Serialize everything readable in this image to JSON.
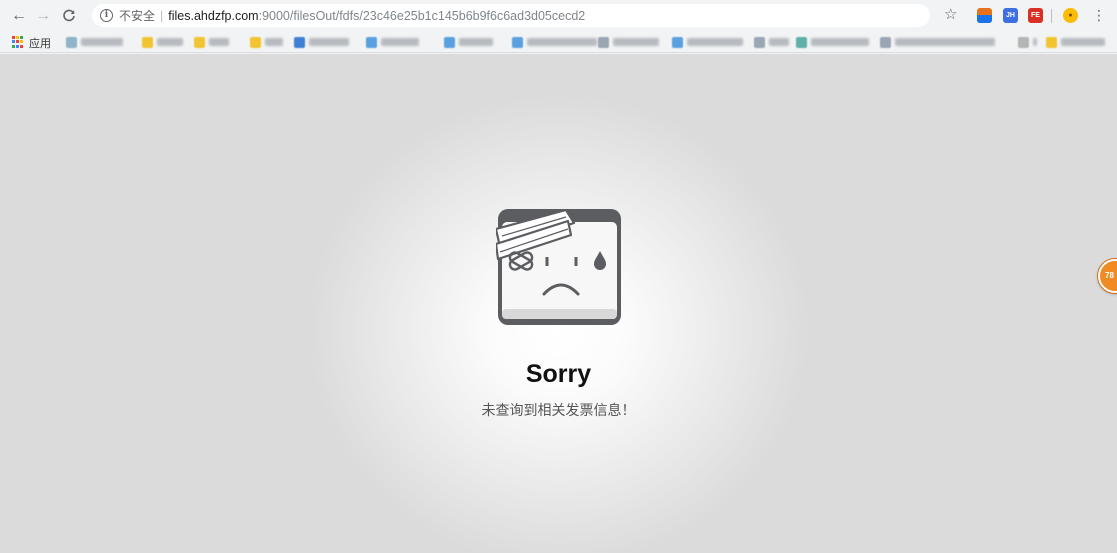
{
  "browser": {
    "url_security_label": "不安全",
    "url_separator": "|",
    "url_host": "files.ahdzfp.com",
    "url_path": ":9000/filesOut/fdfs/23c46e25b1c145b6b9f6c6ad3d05cecd2",
    "extensions": [
      "JH",
      "FE"
    ],
    "icons": [
      "back-arrow-icon",
      "forward-arrow-icon",
      "reload-icon",
      "info-icon",
      "star-icon",
      "menu-icon"
    ]
  },
  "bookmarks": {
    "apps_label": "应用",
    "items_blurred": true
  },
  "page": {
    "title": "Sorry",
    "message": "未查询到相关发票信息！",
    "illustration": "sad-window-bandaged-icon",
    "floating_badge": "78"
  },
  "colors": {
    "page_background": "#dcdbdb",
    "center_glow": "#ffffff",
    "badge": "#f08a24"
  }
}
